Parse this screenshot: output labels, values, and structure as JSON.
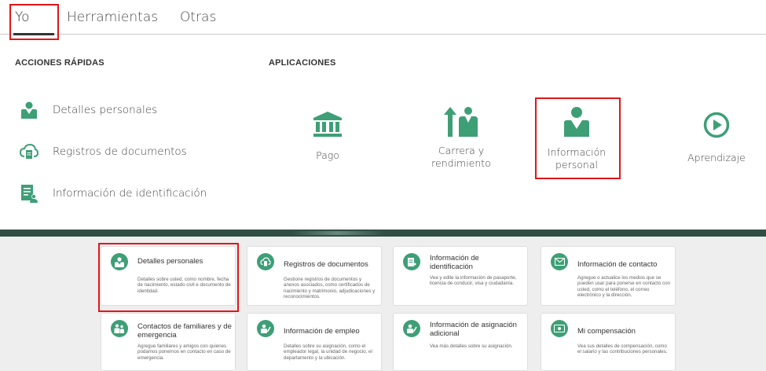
{
  "tabs": [
    {
      "label": "Yo"
    },
    {
      "label": "Herramientas"
    },
    {
      "label": "Otras"
    }
  ],
  "quick_actions": {
    "title": "ACCIONES RÁPIDAS",
    "items": [
      {
        "label": "Detalles personales",
        "icon": "person-icon"
      },
      {
        "label": "Registros de documentos",
        "icon": "cloud-document-icon"
      },
      {
        "label": "Información de identificación",
        "icon": "id-document-icon"
      }
    ]
  },
  "applications": {
    "title": "APLICACIONES",
    "items": [
      {
        "label": "Pago",
        "icon": "bank-icon"
      },
      {
        "label": "Carrera y rendimiento",
        "label_line1": "Carrera y",
        "label_line2": "rendimiento",
        "icon": "career-icon"
      },
      {
        "label": "Información personal",
        "label_line1": "Información",
        "label_line2": "personal",
        "icon": "person-icon"
      },
      {
        "label": "Aprendizaje",
        "icon": "play-circle-icon"
      }
    ]
  },
  "cards": [
    {
      "title": "Detalles personales",
      "description": "Detalles sobre usted, como nombre, fecha de nacimiento, estado civil e documento de identidad.",
      "icon": "person-icon"
    },
    {
      "title": "Registros de documentos",
      "description": "Gestione registros de documentos y anexos asociados, como certificados de nacimiento y matrimonio, adjudicaciones y reconocimientos.",
      "icon": "cloud-document-icon"
    },
    {
      "title": "Información de identificación",
      "description": "Vea y edite la información de pasaporte, licencia de conducir, visa y ciudadanía.",
      "icon": "id-document-icon"
    },
    {
      "title": "Información de contacto",
      "description": "Agregue o actualice los medios que se pueden usar para ponerse en contacto con usted, como el teléfono, el correo electrónico y la dirección.",
      "icon": "envelope-icon"
    },
    {
      "title": "Contactos de familiares y de emergencia",
      "description": "Agregue familiares y amigos con quienes podamos ponernos en contacto en caso de emergencia.",
      "icon": "family-icon"
    },
    {
      "title": "Información de empleo",
      "description": "Detalles sobre su asignación, como el empleador legal, la unidad de negocio, el departamento y la ubicación.",
      "icon": "employment-icon"
    },
    {
      "title": "Información de asignación adicional",
      "description": "Vea más detalles sobre su asignación.",
      "icon": "assignment-icon"
    },
    {
      "title": "Mi compensación",
      "description": "Vea sus detalles de compensación, como el salario y las contribuciones personales.",
      "icon": "money-icon"
    }
  ],
  "colors": {
    "accent": "#3e9f77",
    "highlight": "#e0161a",
    "band": "#2f4f45"
  }
}
